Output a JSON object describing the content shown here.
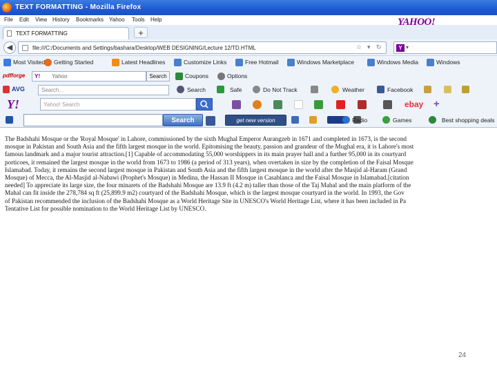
{
  "window": {
    "title": "TEXT FORMATTING - Mozilla Firefox"
  },
  "menu": [
    "File",
    "Edit",
    "View",
    "History",
    "Bookmarks",
    "Yahoo",
    "Tools",
    "Help"
  ],
  "tabs": [
    {
      "label": "TEXT FORMATTING"
    }
  ],
  "new_tab_symbol": "+",
  "address_bar": {
    "url": "file:///C:/Documents and Settings/bashara/Desktop/WEB DESIGNING/Lecture 12/TD.HTML"
  },
  "yahoo_brand": "YAHOO!",
  "bookmarks": [
    "Most Visited",
    "Getting Started",
    "Latest Headlines",
    "Customize Links",
    "Free Hotmail",
    "Windows Marketplace",
    "Windows Media",
    "Windows"
  ],
  "pdfforge_toolbar": {
    "brand": "pdfforge",
    "yahoo_label": "Yahoo",
    "search_button": "Search",
    "coupons_label": "Coupons",
    "options_label": "Options"
  },
  "avg_toolbar": {
    "brand": "AVG",
    "search_placeholder": "Search...",
    "search_label": "Search",
    "safe_label": "Safe",
    "do_not_track_label": "Do Not Track",
    "weather_label": "Weather",
    "facebook_label": "Facebook"
  },
  "yahoo_toolbar": {
    "logo": "Y!",
    "search_placeholder": "Yahoo! Search",
    "ebay_label": "ebay",
    "plus_label": "+"
  },
  "search_toolbar": {
    "search_button": "Search",
    "new_version_label": "get new version",
    "radio_label": "Radio",
    "games_label": "Games",
    "deals_label": "Best shopping deals"
  },
  "document": {
    "lines": [
      "The Badshahi Mosque or the 'Royal Mosque' in Lahore, commissioned by the sixth Mughal Emperor Aurangzeb in 1671 and completed in 1673, is the second",
      "mosque in Pakistan and South Asia and the fifth largest mosque in the world. Epitomising the beauty, passion and grandeur of the Mughal era, it is Lahore's most",
      "famous landmark and a major tourist attraction.[1] Capable of accommodating 55,000 worshippers in its main prayer hall and a further 95,000 in its courtyard",
      "porticoes, it remained the largest mosque in the world from 1673 to 1986 (a period of 313 years), when overtaken in size by the completion of the Faisal Mosque",
      "Islamabad. Today, it remains the second largest mosque in Pakistan and South Asia and the fifth largest mosque in the world after the Masjid al-Haram (Grand",
      "Mosque) of Mecca, the Al-Masjid al-Nabawi (Prophet's Mosque) in Medina, the Hassan II Mosque in Casablanca and the Faisal Mosque in Islamabad.[citation",
      "needed] To appreciate its large size, the four minarets of the Badshahi Mosque are 13.9 ft (4.2 m) taller than those of the Taj Mahal and the main platform of the",
      "Mahal can fit inside the 278,784 sq ft (25,899.9 m2) courtyard of the Badshahi Mosque, which is the largest mosque courtyard in the world. In 1993, the Gov",
      "of Pakistan recommended the inclusion of the Badshahi Mosque as a World Heritage Site in UNESCO's World Heritage List, where it has been included in Pa",
      "Tentative List for possible nomination to the World Heritage List by UNESCO."
    ]
  },
  "page_number": "24"
}
